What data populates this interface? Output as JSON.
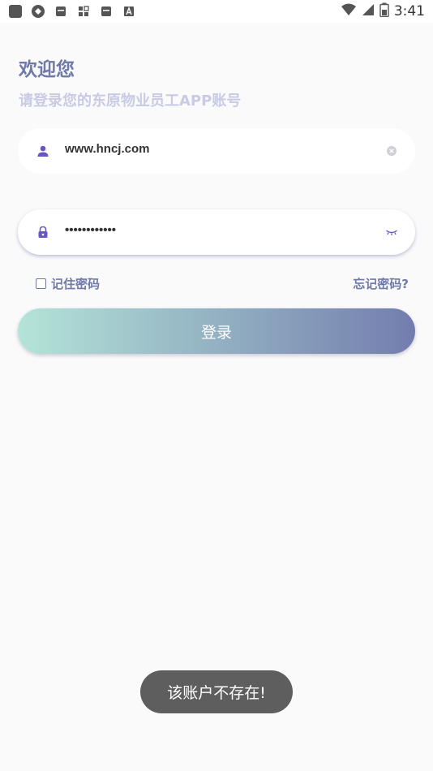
{
  "status_bar": {
    "time": "3:41",
    "left_icons": [
      "app-square-icon",
      "vpn-icon",
      "message-icon",
      "grid-app-icon",
      "mail-icon",
      "font-a-icon"
    ],
    "right_icons": [
      "wifi-icon",
      "signal-icon",
      "battery-icon"
    ]
  },
  "header": {
    "title": "欢迎您",
    "subtitle": "请登录您的东原物业员工APP账号"
  },
  "form": {
    "username": {
      "value": "www.hncj.com",
      "lead_icon": "user-icon",
      "trail_icon": "clear-icon"
    },
    "password": {
      "value": "••••••••••••",
      "lead_icon": "lock-icon",
      "trail_icon": "eye-closed-icon"
    },
    "remember_label": "记住密码",
    "remember_checked": false,
    "forgot_label": "忘记密码?",
    "login_label": "登录"
  },
  "toast": {
    "message": "该账户不存在!"
  },
  "colors": {
    "accent": "#6f7aa8",
    "subtitle": "#c9cbe6",
    "icon": "#6a55c4",
    "gradient_start": "#b4e4d8",
    "gradient_end": "#737dae",
    "toast_bg": "#5e5e5e"
  }
}
